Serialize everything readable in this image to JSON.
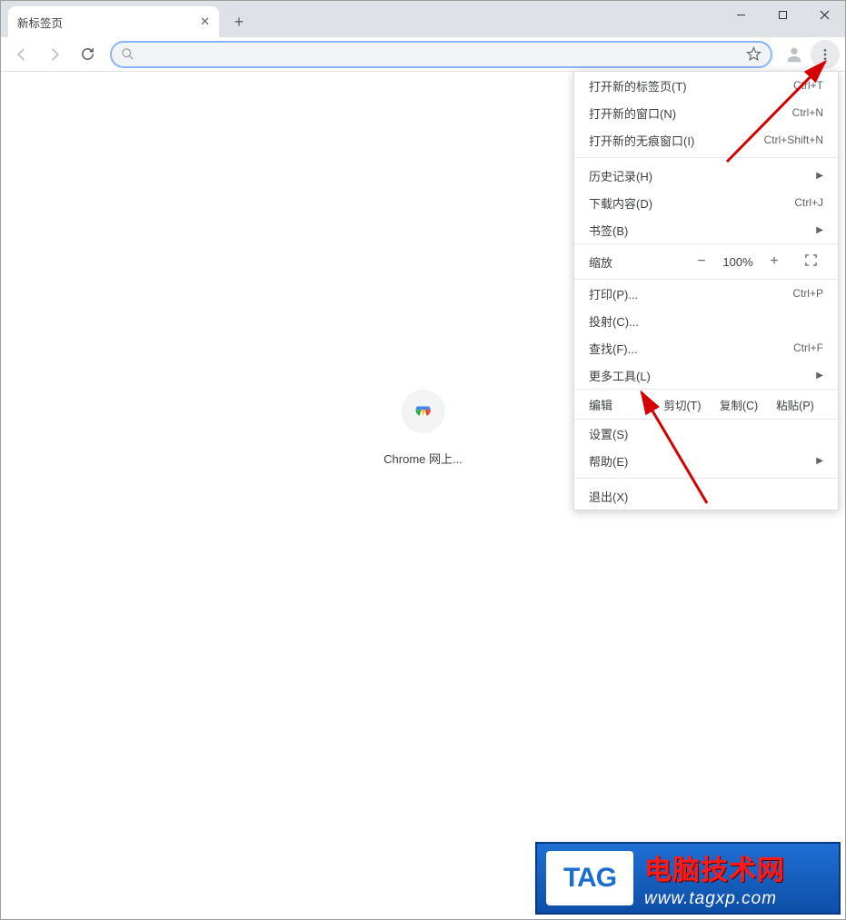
{
  "tab": {
    "title": "新标签页"
  },
  "content": {
    "app_label": "Chrome 网上..."
  },
  "menu": {
    "new_tab": "打开新的标签页(T)",
    "new_tab_sc": "Ctrl+T",
    "new_window": "打开新的窗口(N)",
    "new_window_sc": "Ctrl+N",
    "new_incognito": "打开新的无痕窗口(I)",
    "new_incognito_sc": "Ctrl+Shift+N",
    "history": "历史记录(H)",
    "downloads": "下载内容(D)",
    "downloads_sc": "Ctrl+J",
    "bookmarks": "书签(B)",
    "zoom_label": "缩放",
    "zoom_value": "100%",
    "print": "打印(P)...",
    "print_sc": "Ctrl+P",
    "cast": "投射(C)...",
    "find": "查找(F)...",
    "find_sc": "Ctrl+F",
    "more_tools": "更多工具(L)",
    "edit_label": "编辑",
    "cut": "剪切(T)",
    "copy": "复制(C)",
    "paste": "粘贴(P)",
    "settings": "设置(S)",
    "help": "帮助(E)",
    "exit": "退出(X)"
  },
  "watermark": {
    "tag": "TAG",
    "cn": "电脑技术网",
    "url": "www.tagxp.com"
  }
}
